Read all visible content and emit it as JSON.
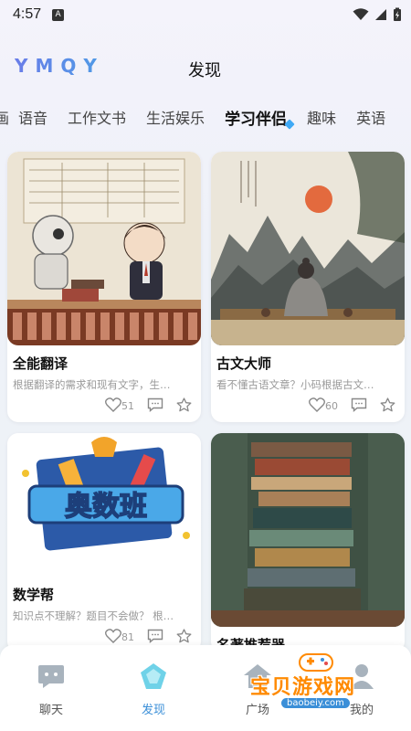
{
  "status_bar": {
    "time": "4:57",
    "app_indicator": "A"
  },
  "header": {
    "logo_text": "YMQY",
    "title": "发现"
  },
  "tabs": [
    {
      "label": "画"
    },
    {
      "label": "语音"
    },
    {
      "label": "工作文书"
    },
    {
      "label": "生活娱乐"
    },
    {
      "label": "学习伴侣",
      "active": true
    },
    {
      "label": "趣味"
    },
    {
      "label": "英语"
    }
  ],
  "cards": [
    {
      "title": "全能翻译",
      "desc": "根据翻译的需求和现有文字，生…",
      "likes": "51"
    },
    {
      "title": "古文大师",
      "desc": "看不懂古语文章？小码根据古文…",
      "likes": "60"
    },
    {
      "title": "数学帮",
      "desc": "知识点不理解？题目不会做？ 根…",
      "likes": "81",
      "image_text": "奥数班"
    },
    {
      "title": "名著推荐器",
      "desc": "",
      "likes": ""
    }
  ],
  "bottom_nav": [
    {
      "label": "聊天",
      "icon": "chat-icon"
    },
    {
      "label": "发现",
      "icon": "discover-icon",
      "active": true
    },
    {
      "label": "广场",
      "icon": "square-icon"
    },
    {
      "label": "我的",
      "icon": "profile-icon"
    }
  ],
  "watermark": {
    "text": "宝贝游戏网",
    "url": "baobeiy.com"
  },
  "colors": {
    "accent": "#3b8fd8",
    "tab_indicator": "#3fa9f5",
    "watermark": "#ff8a00"
  }
}
